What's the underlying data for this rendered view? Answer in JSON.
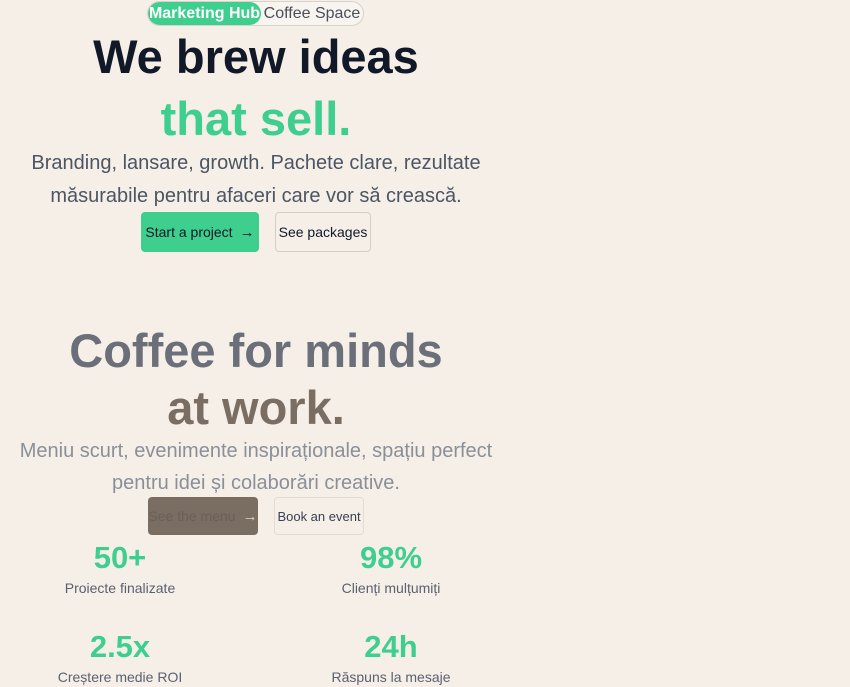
{
  "toggle": {
    "active_label": "Marketing Hub",
    "inactive_label": "Coffee Space"
  },
  "hero": {
    "title_line1": "We brew ideas",
    "title_line2": "that sell.",
    "subtitle_line1": "Branding, lansare, growth. Pachete clare, rezultate",
    "subtitle_line2": "măsurabile pentru afaceri care vor să crească.",
    "primary_button": "Start a project",
    "secondary_button": "See packages"
  },
  "coffee": {
    "title_line1": "Coffee for minds",
    "title_line2": "at work.",
    "subtitle_line1": "Meniu scurt, evenimente inspiraționale, spațiu perfect",
    "subtitle_line2": "pentru idei și colaborări creative.",
    "primary_button": "See the menu",
    "secondary_button": "Book an event"
  },
  "stats": [
    {
      "value": "50+",
      "label": "Proiecte finalizate"
    },
    {
      "value": "98%",
      "label": "Clienți mulțumiți"
    },
    {
      "value": "2.5x",
      "label": "Creștere medie ROI"
    },
    {
      "value": "24h",
      "label": "Răspuns la mesaje"
    }
  ],
  "icons": {
    "arrow": "arrow-right-icon"
  },
  "colors": {
    "accent": "#3ecf8e",
    "background": "#f5efe8",
    "coffee_brown": "#7a6e63"
  }
}
